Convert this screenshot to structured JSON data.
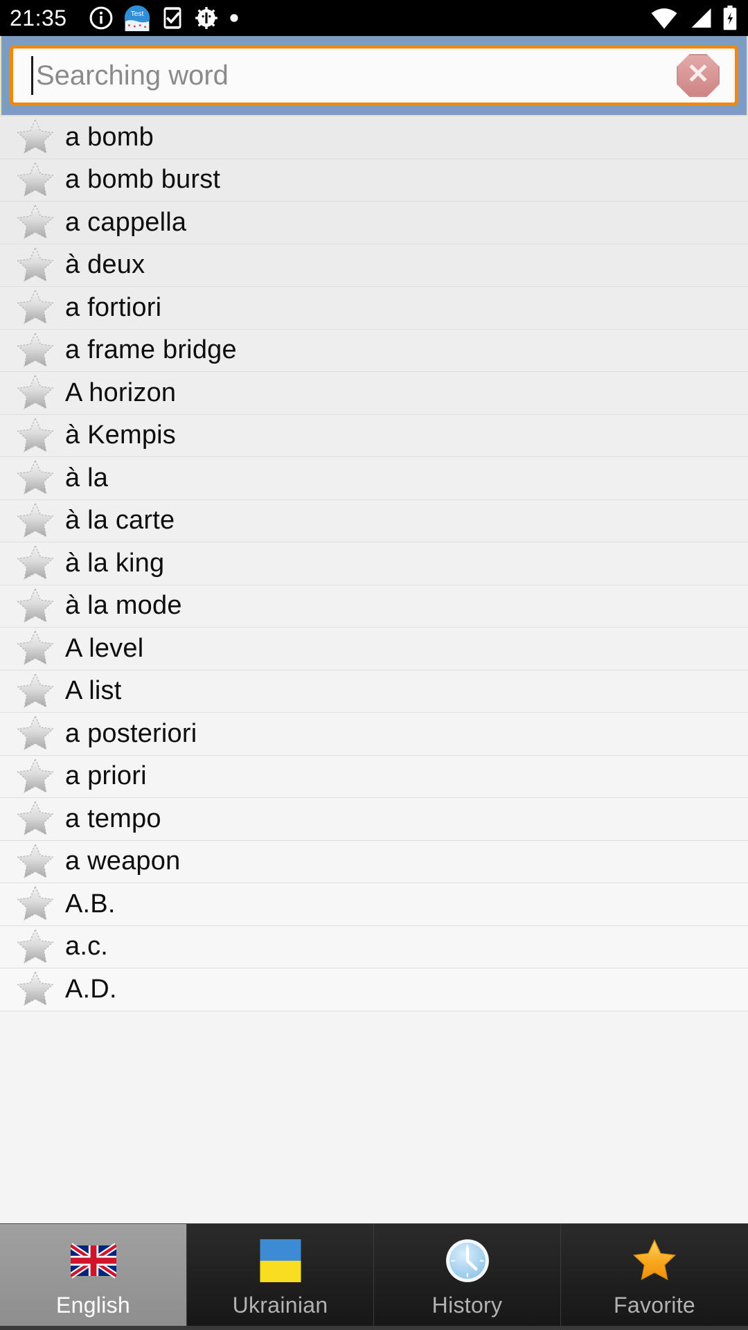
{
  "statusbar": {
    "time": "21:35",
    "left_icons": [
      "info-circle-icon",
      "test-app-icon",
      "phone-check-icon",
      "android-bug-icon",
      "dot-icon"
    ],
    "right_icons": [
      "wifi-icon",
      "cellular-signal-icon",
      "battery-charging-icon"
    ],
    "test_icon_label": "Test",
    "background": "#000000",
    "foreground": "#ffffff"
  },
  "search": {
    "placeholder": "Searching word",
    "value": "",
    "clear_label": "✕",
    "clear_icon": "clear-octagon-icon",
    "panel_color": "#7d9cc3",
    "border_color": "#f0870f"
  },
  "list": {
    "favorite_icon": "star-outline-icon",
    "items": [
      {
        "word": "a bomb"
      },
      {
        "word": "a bomb burst"
      },
      {
        "word": "a cappella"
      },
      {
        "word": "à deux"
      },
      {
        "word": "a fortiori"
      },
      {
        "word": "a frame bridge"
      },
      {
        "word": "A horizon"
      },
      {
        "word": "à Kempis"
      },
      {
        "word": "à la"
      },
      {
        "word": "à la carte"
      },
      {
        "word": "à la king"
      },
      {
        "word": "à la mode"
      },
      {
        "word": "A level"
      },
      {
        "word": "A list"
      },
      {
        "word": "a posteriori"
      },
      {
        "word": "a priori"
      },
      {
        "word": "a tempo"
      },
      {
        "word": "a weapon"
      },
      {
        "word": "A.B."
      },
      {
        "word": "a.c."
      },
      {
        "word": "A.D."
      }
    ]
  },
  "tabbar": {
    "tabs": [
      {
        "label": "English",
        "icon": "uk-flag-icon",
        "active": true
      },
      {
        "label": "Ukrainian",
        "icon": "ukraine-flag-icon",
        "active": false
      },
      {
        "label": "History",
        "icon": "clock-icon",
        "active": false
      },
      {
        "label": "Favorite",
        "icon": "star-filled-icon",
        "active": false
      }
    ],
    "active_background": "#999999",
    "inactive_background": "#1c1c1c",
    "favorite_star_color": "#f5a623"
  }
}
